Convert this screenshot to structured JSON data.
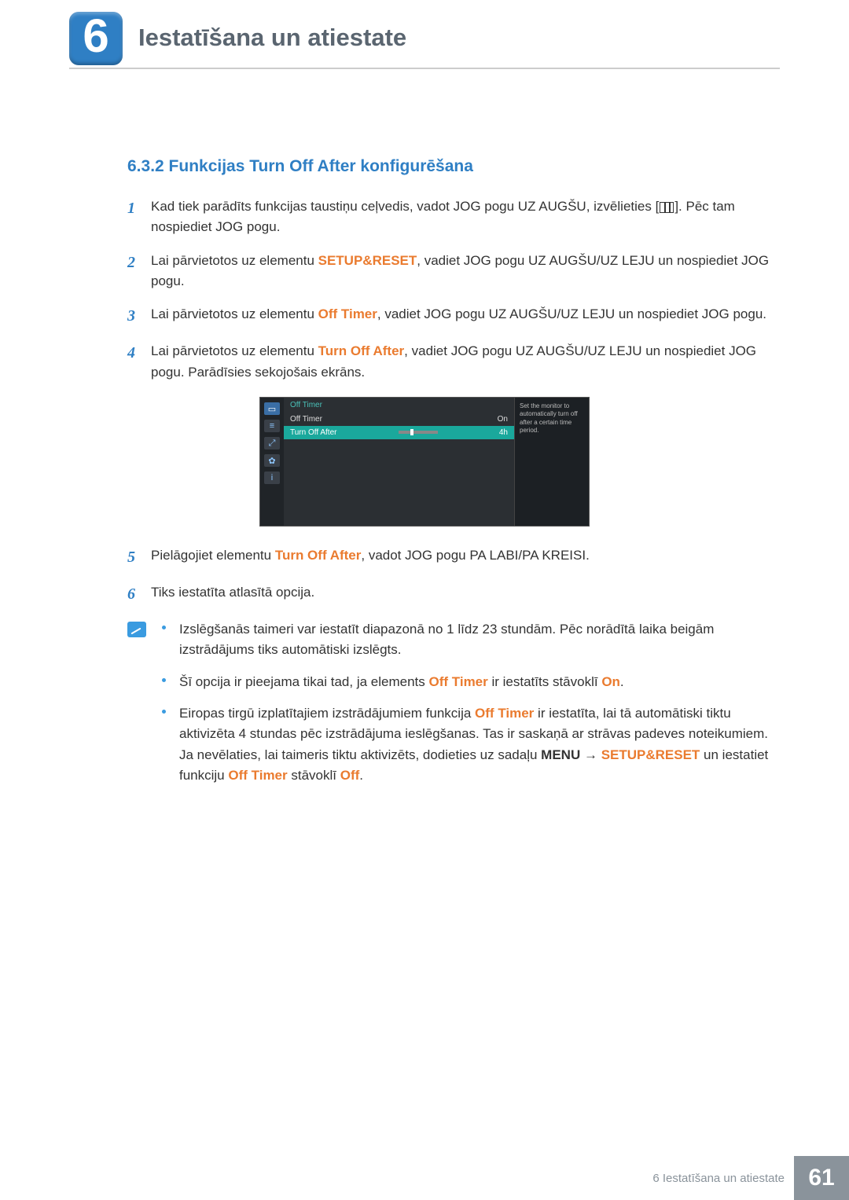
{
  "chapter": {
    "number": "6",
    "title": "Iestatīšana un atiestate"
  },
  "section": {
    "heading": "6.3.2   Funkcijas Turn Off After konfigurēšana"
  },
  "steps": {
    "1": {
      "a": "Kad tiek parādīts funkcijas taustiņu ceļvedis, vadot JOG pogu UZ AUGŠU, izvēlieties [",
      "b": "]. Pēc tam nospiediet JOG pogu."
    },
    "2": {
      "pre": "Lai pārvietotos uz elementu ",
      "em": "SETUP&RESET",
      "post": ", vadiet JOG pogu UZ AUGŠU/UZ LEJU un nospiediet JOG pogu."
    },
    "3": {
      "pre": "Lai pārvietotos uz elementu ",
      "em": "Off Timer",
      "post": ", vadiet JOG pogu UZ AUGŠU/UZ LEJU un nospiediet JOG pogu."
    },
    "4": {
      "pre": "Lai pārvietotos uz elementu ",
      "em": "Turn Off After",
      "post": ", vadiet JOG pogu UZ AUGŠU/UZ LEJU un nospiediet JOG pogu. Parādīsies sekojošais ekrāns."
    },
    "5": {
      "pre": "Pielāgojiet elementu ",
      "em": "Turn Off After",
      "post": ", vadot JOG pogu PA LABI/PA KREISI."
    },
    "6": {
      "text": "Tiks iestatīta atlasītā opcija."
    }
  },
  "osd": {
    "title": "Off Timer",
    "row1_label": "Off Timer",
    "row1_value": "On",
    "row2_label": "Turn Off After",
    "row2_value": "4h",
    "hint": "Set the monitor to automatically turn off after a certain time period."
  },
  "notes": {
    "0": "Izslēgšanās taimeri var iestatīt diapazonā no 1 līdz 23 stundām. Pēc norādītā laika beigām izstrādājums tiks automātiski izslēgts.",
    "1": {
      "a": "Šī opcija ir pieejama tikai tad, ja elements ",
      "em1": "Off Timer",
      "b": " ir iestatīts stāvoklī ",
      "em2": "On",
      "c": "."
    },
    "2": {
      "a": "Eiropas tirgū izplatītajiem izstrādājumiem funkcija ",
      "em1": "Off Timer",
      "b": " ir iestatīta, lai tā automātiski tiktu aktivizēta 4 stundas pēc izstrādājuma ieslēgšanas. Tas ir saskaņā ar strāvas padeves noteikumiem. Ja nevēlaties, lai taimeris tiktu aktivizēts, dodieties uz sadaļu ",
      "em2": "MENU",
      "arrow": "  →  ",
      "em3": "SETUP&RESET",
      "c": " un iestatiet funkciju ",
      "em4": "Off Timer",
      "d": " stāvoklī ",
      "em5": "Off",
      "e": "."
    }
  },
  "footer": {
    "text": "6 Iestatīšana un atiestate",
    "page": "61"
  }
}
